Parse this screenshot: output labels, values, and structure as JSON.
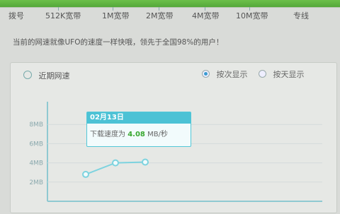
{
  "tabs": [
    "拨号",
    "512K宽带",
    "1M宽带",
    "2M宽带",
    "4M宽带",
    "10M宽带",
    "专线"
  ],
  "slogan": "当前的网速就像UFO的速度一样快哦，领先于全国98%的用户！",
  "panel": {
    "title": "近期网速",
    "radio_times": "按次显示",
    "radio_days": "按天显示"
  },
  "chart_data": {
    "type": "line",
    "y_ticks": [
      "8MB",
      "6MB",
      "4MB",
      "2MB"
    ],
    "points": [
      {
        "index": 1,
        "value": 2.8
      },
      {
        "index": 2,
        "value": 4.0
      },
      {
        "index": 3,
        "value": 4.08
      }
    ],
    "ylim": [
      0,
      10
    ]
  },
  "tooltip": {
    "date": "02月13日",
    "label": "下载速度为",
    "value": "4.08",
    "unit": "MB/秒"
  },
  "colors": {
    "top_bar": "#54a83a",
    "line": "#7dd3df",
    "tooltip": "#4cc2d5",
    "value": "#39a82f"
  }
}
